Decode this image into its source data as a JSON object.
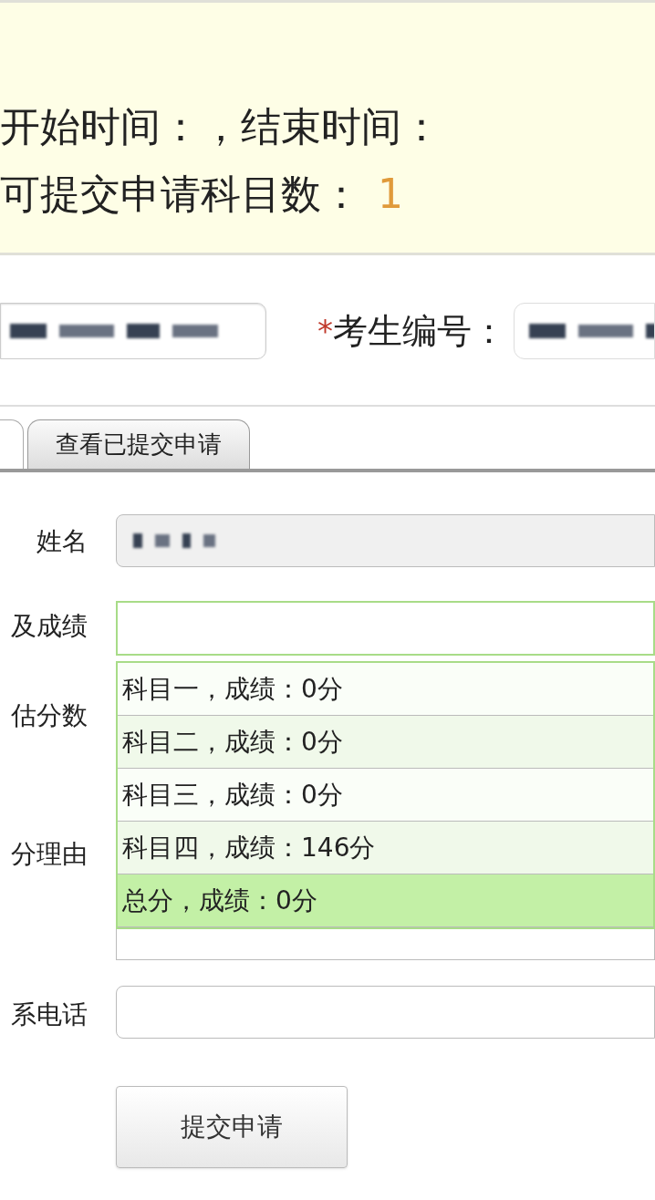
{
  "notice": {
    "schedule_line": "开始时间：，结束时间：",
    "subject_count_label": "可提交申请科目数：",
    "subject_count": "1"
  },
  "identity": {
    "required_mark": "*",
    "id_label": "考生编号："
  },
  "tabs": [
    {
      "kind": "cut",
      "selected": true
    },
    {
      "kind": "full",
      "label": "查看已提交申请",
      "selected": false
    }
  ],
  "form": [
    {
      "kind": "text",
      "label": "姓名",
      "disabled": true,
      "redacted": true
    },
    {
      "kind": "select",
      "label": "及成绩",
      "expanded": true,
      "options": [
        {
          "label": "科目一，成绩：0分",
          "selected": false
        },
        {
          "label": "科目二，成绩：0分",
          "selected": false
        },
        {
          "label": "科目三，成绩：0分",
          "selected": false
        },
        {
          "label": "科目四，成绩：146分",
          "selected": false
        },
        {
          "label": "总分，成绩：0分",
          "selected": true
        }
      ]
    },
    {
      "kind": "hidden",
      "label": "估分数"
    },
    {
      "kind": "textarea",
      "label": "分理由"
    },
    {
      "kind": "text",
      "label": "系电话",
      "disabled": false,
      "redacted": false
    }
  ],
  "submit": "提交申请"
}
